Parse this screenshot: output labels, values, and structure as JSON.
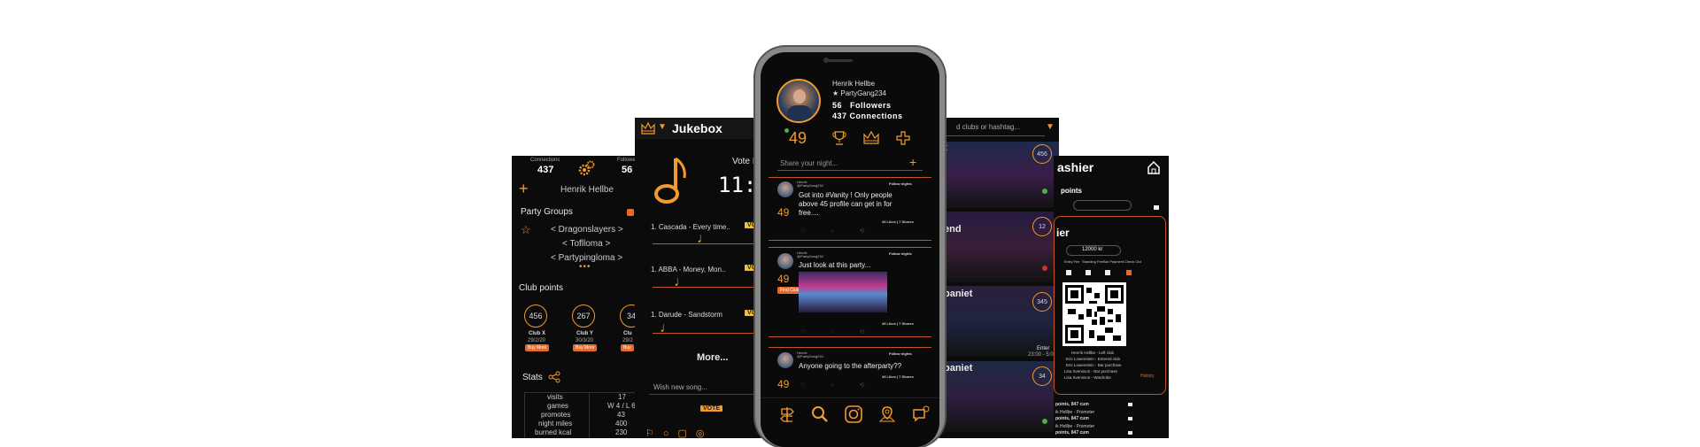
{
  "screen1": {
    "connections_label": "Connections",
    "connections_value": "437",
    "followers_label": "Followe",
    "followers_value": "56",
    "user_name": "Henrik Hellbe",
    "party_groups_title": "Party Groups",
    "groups": [
      "< Dragonslayers >",
      "< Toflloma >",
      "< Partypingloma >"
    ],
    "club_points_title": "Club points",
    "clubs": [
      {
        "points": "456",
        "name": "Club X",
        "date": "29/2/20",
        "badge": "Buy More"
      },
      {
        "points": "267",
        "name": "Club Y",
        "date": "30/3/20",
        "badge": "Buy More"
      },
      {
        "points": "34",
        "name": "Clu",
        "date": "29/2",
        "badge": "Buy"
      }
    ],
    "stats_title": "Stats",
    "stats": [
      {
        "label": "visits",
        "value": "17"
      },
      {
        "label": "games",
        "value": "W 4 / L 6"
      },
      {
        "label": "promotes",
        "value": "43"
      },
      {
        "label": "night miles",
        "value": "400"
      },
      {
        "label": "burned kcal",
        "value": "230"
      }
    ]
  },
  "screen2": {
    "title": "Jukebox",
    "vote_label": "Vote I",
    "time": "11:",
    "songs": [
      "1. Cascada - Every time..",
      "1. ABBA - Money, Mon..",
      "1. Darude - Sandstorm"
    ],
    "vote_btn": "VO",
    "more": "More...",
    "wish_placeholder": "Wish new song...",
    "vote_submit": "VOTE"
  },
  "phone": {
    "name": "Henrik Hellbe",
    "group": "★ PartyGang234",
    "followers": "56   Followers",
    "connections": "437 Connections",
    "score": "49",
    "share_placeholder": "Share your night...",
    "posts": [
      {
        "author": "Henrik",
        "handle": "@PartyGang234",
        "follow": "Follow nights",
        "score": "49",
        "text": "Got into #Vanity ! Only people above 45 profile can get in for free....",
        "stats": "49 Likes | 7 Shares",
        "tag": ""
      },
      {
        "author": "Henrik",
        "handle": "@PartyGang234",
        "follow": "Follow nights",
        "score": "49",
        "text": "Just look at this party...",
        "stats": "49 Likes | 7 Shares",
        "tag": "Find Club"
      },
      {
        "author": "Henrik",
        "handle": "@PartyGang234",
        "follow": "Follow nights",
        "score": "49",
        "text": "Anyone going to the afterparty??",
        "stats": "49 Likes | 7 Shares",
        "tag": ""
      }
    ]
  },
  "screen4": {
    "search_placeholder": "d clubs or hashtag...",
    "clubs": [
      {
        "label": "t",
        "count": "456"
      },
      {
        "label": "end",
        "count": "12"
      },
      {
        "label": "paniet",
        "count": "345"
      },
      {
        "label": "paniet",
        "count": "34"
      }
    ],
    "enter_label": "Enter",
    "enter_time": "23:00 - 5:00"
  },
  "screen5": {
    "title": "ashier",
    "points_label": "points",
    "cashier_label": "ier",
    "amount": "12000 kr",
    "options": [
      "Entry Fee",
      "Standing Fee",
      "Bar Payment",
      "Check Out"
    ],
    "history": "History",
    "log": [
      "Henrik Hellbe - Left club",
      "Eric Lowenstein - Entered club",
      "Eric Lowenstein - Bar purchase",
      "Lisa Svensson - Bar purchase",
      "Lisa Svensson - Wardrobe",
      "points, 847 cum",
      "ik Hellbe - Promoter",
      "points, 847 cum",
      "ik Hellbe - Promoter",
      "points, 847 cum"
    ]
  }
}
